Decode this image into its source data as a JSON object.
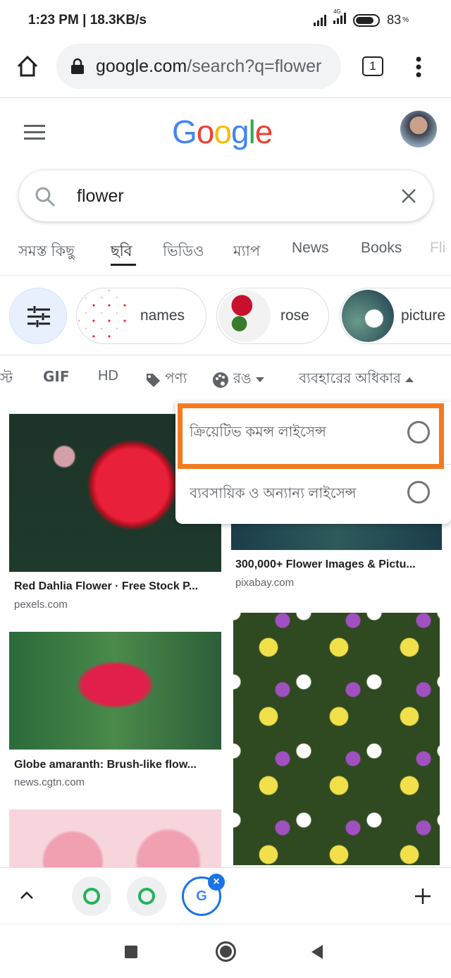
{
  "status": {
    "time": "1:23 PM",
    "speed": "18.3KB/s",
    "network": "4G",
    "battery": "83",
    "battery_unit": "%",
    "battery_level": 0.83
  },
  "browser": {
    "url_host": "google.com",
    "url_path": "/search?q=flower",
    "tab_count": "1"
  },
  "google": {
    "logo": "Google",
    "query": "flower"
  },
  "tabs": [
    {
      "label": "সমস্ত কিছু"
    },
    {
      "label": "ছবি",
      "active": true
    },
    {
      "label": "ভিডিও"
    },
    {
      "label": "ম্যাপ"
    },
    {
      "label": "News"
    },
    {
      "label": "Books"
    },
    {
      "label": "Fli"
    }
  ],
  "chips": [
    {
      "label": "names"
    },
    {
      "label": "rose"
    },
    {
      "label": "picture"
    }
  ],
  "filters": {
    "partial": "স্ট",
    "gif": "GIF",
    "hd": "HD",
    "product": "পণ্য",
    "color": "রঙ",
    "usage_rights": "ব্যবহারের অধিকার"
  },
  "dropdown": {
    "items": [
      {
        "label": "ক্রিয়েটিভ কমন্স লাইসেন্স",
        "selected": false
      },
      {
        "label": "ব্যবসায়িক ও অন্যান্য লাইসেন্স",
        "selected": false
      }
    ],
    "highlight_color": "#f47a20"
  },
  "results": [
    {
      "title": "Red Dahlia Flower · Free Stock P...",
      "source": "pexels.com"
    },
    {
      "title": "300,000+ Flower Images & Pictu...",
      "source": "pixabay.com"
    },
    {
      "title": "Globe amaranth: Brush-like flow...",
      "source": "news.cgtn.com"
    }
  ]
}
